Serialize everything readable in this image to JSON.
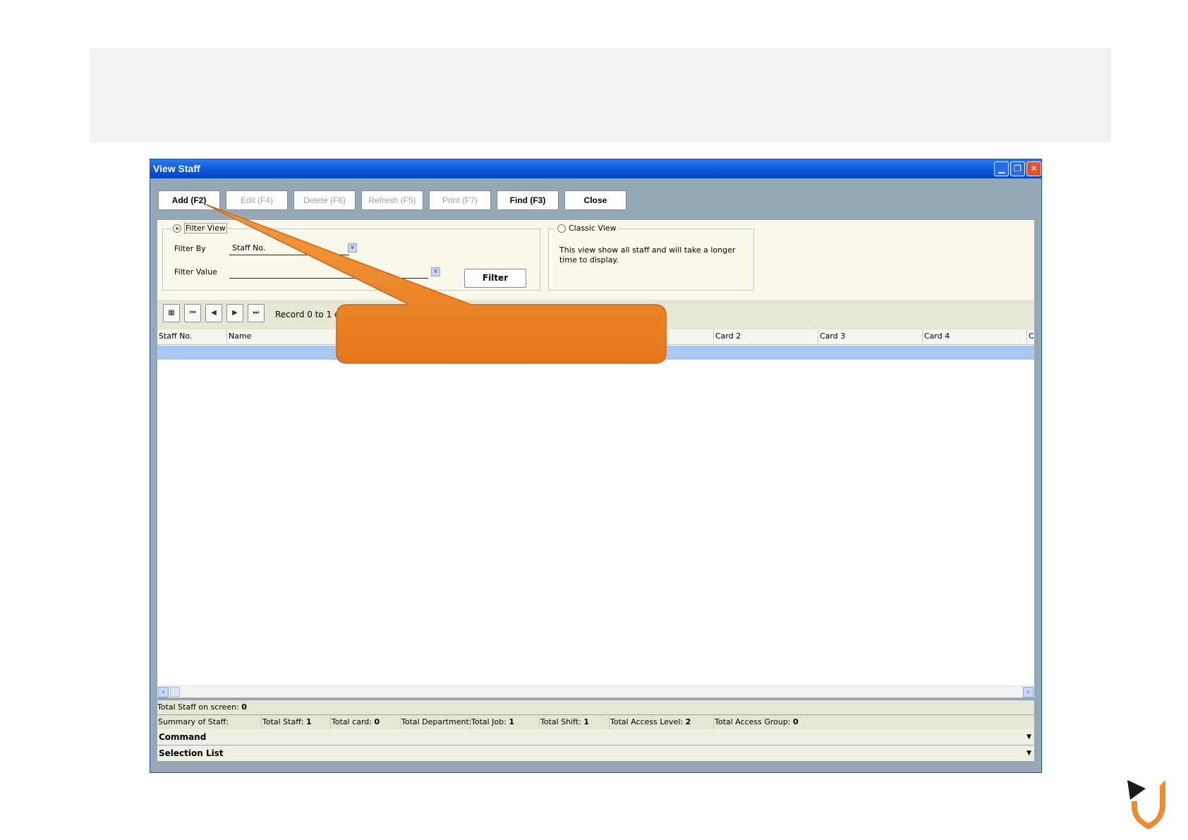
{
  "window": {
    "title": "View Staff"
  },
  "toolbar": {
    "add": "Add (F2)",
    "edit": "Edit (F4)",
    "delete": "Delete (F6)",
    "refresh": "Refresh (F5)",
    "print": "Print (F7)",
    "find": "Find (F3)",
    "close": "Close"
  },
  "filter_view": {
    "legend": "Filter View",
    "filter_by_label": "Filter By",
    "filter_by_value": "Staff No.",
    "filter_value_label": "Filter Value",
    "filter_value": "",
    "filter_button": "Filter",
    "selected": true
  },
  "classic_view": {
    "legend": "Classic View",
    "description": "This view show all staff and will take a longer time to display.",
    "selected": false
  },
  "navigator": {
    "record_text": "Record 0 to 1 of 0"
  },
  "grid": {
    "columns": [
      "Staff No.",
      "Name",
      "Card 2",
      "Card 3",
      "Card 4",
      "C"
    ]
  },
  "status": {
    "total_on_screen_label": "Total Staff on screen:",
    "total_on_screen_value": "0",
    "summary_label": "Summary of Staff:",
    "total_staff_label": "Total Staff:",
    "total_staff_value": "1",
    "total_card_label": "Total card:",
    "total_card_value": "0",
    "total_department_label": "Total Department:",
    "total_department_value": "",
    "total_job_label": "Total Job:",
    "total_job_value": "1",
    "total_shift_label": "Total Shift:",
    "total_shift_value": "1",
    "total_access_level_label": "Total Access Level:",
    "total_access_level_value": "2",
    "total_access_group_label": "Total Access Group:",
    "total_access_group_value": "0"
  },
  "sections": {
    "command": "Command",
    "selection_list": "Selection List"
  },
  "colors": {
    "callout": "#f08a2a",
    "titlebar": "#0a54d8",
    "selected_row": "#a9c8ef"
  }
}
